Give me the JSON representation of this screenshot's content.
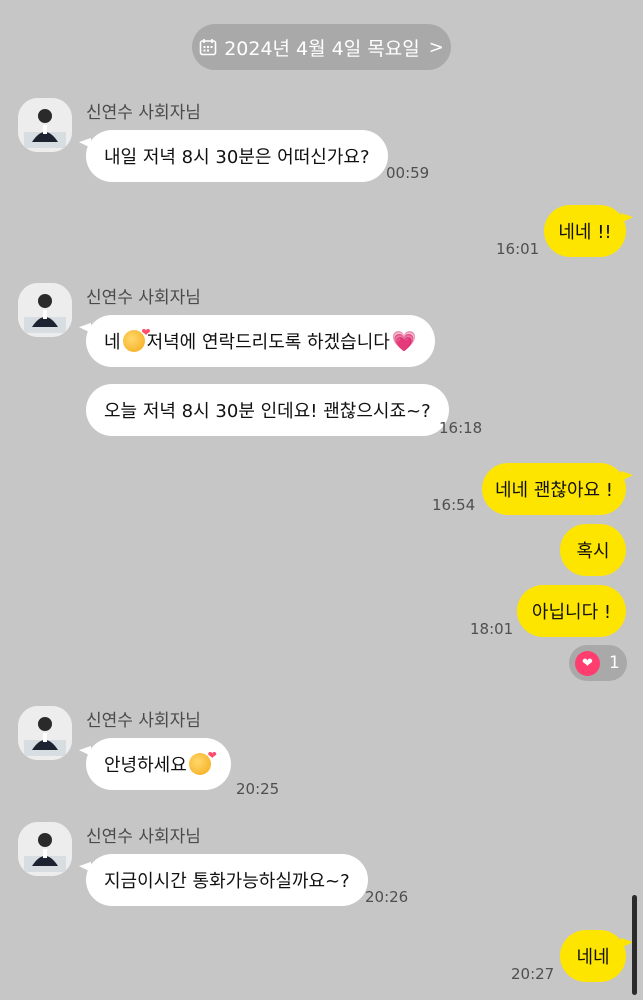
{
  "date_divider": {
    "text": "2024년 4월 4일 목요일"
  },
  "sender_name": "신연수 사회자님",
  "messages": {
    "m1": {
      "text": "내일 저녁 8시 30분은 어떠신가요?",
      "time": "00:59"
    },
    "m2": {
      "text": "네네 !!",
      "time": "16:01"
    },
    "m3": {
      "prefix": "네",
      "text": " 저녁에 연락드리도록 하겠습니다"
    },
    "m4": {
      "text": "오늘 저녁 8시 30분 인데요! 괜찮으시죠~?",
      "time": "16:18"
    },
    "m5": {
      "text": "네네 괜찮아요 !",
      "time": "16:54"
    },
    "m6": {
      "text": "혹시"
    },
    "m7": {
      "text": "아닙니다 !",
      "time": "18:01"
    },
    "m8": {
      "text": "안녕하세요",
      "time": "20:25"
    },
    "m9": {
      "text": "지금이시간 통화가능하실까요~?",
      "time": "20:26"
    },
    "m10": {
      "text": "네네",
      "time": "20:27"
    }
  },
  "reaction": {
    "count": "1",
    "icon": "heart-icon"
  },
  "colors": {
    "background": "#c6c6c6",
    "outgoing": "#fee500",
    "incoming": "#ffffff"
  }
}
